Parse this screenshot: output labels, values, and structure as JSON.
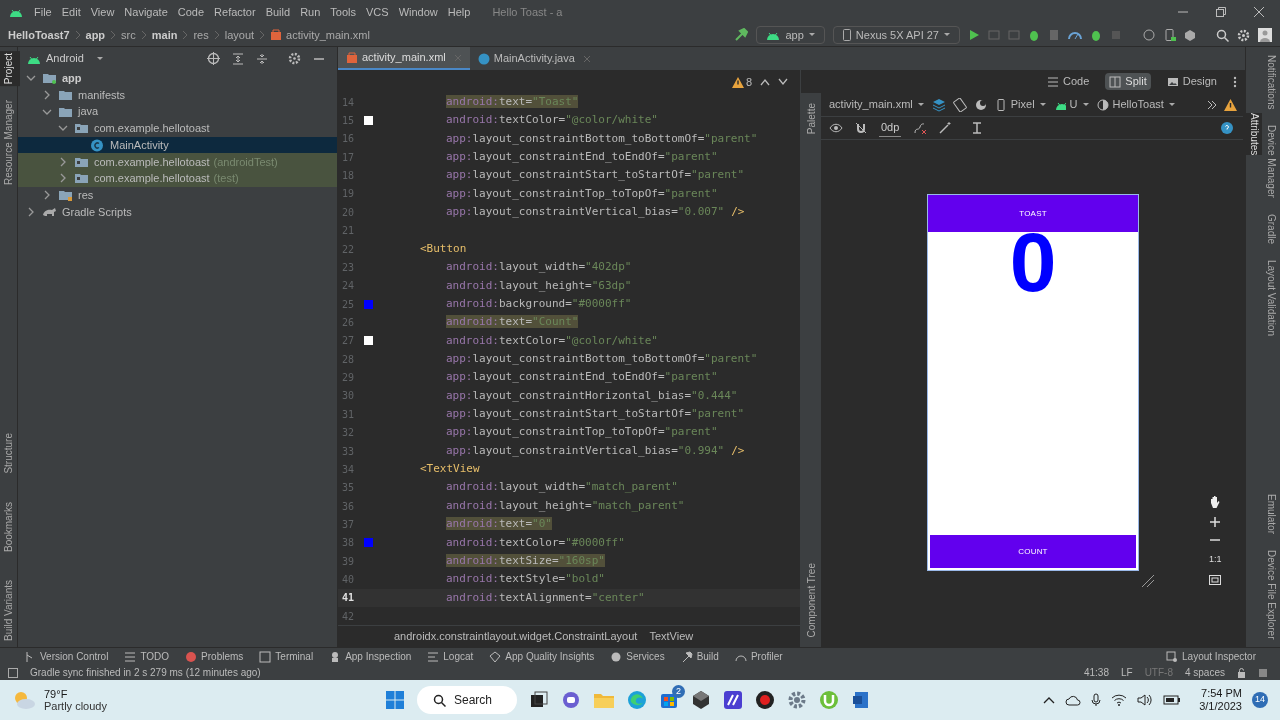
{
  "menu_bar": {
    "items": [
      "File",
      "Edit",
      "View",
      "Navigate",
      "Code",
      "Refactor",
      "Build",
      "Run",
      "Tools",
      "VCS",
      "Window",
      "Help"
    ],
    "title": "Hello Toast - a"
  },
  "breadcrumbs": [
    {
      "label": "HelloToast7",
      "bold": true
    },
    {
      "label": "app",
      "bold": true
    },
    {
      "label": "src",
      "bold": false
    },
    {
      "label": "main",
      "bold": true
    },
    {
      "label": "res",
      "bold": false
    },
    {
      "label": "layout",
      "bold": false
    },
    {
      "label": "activity_main.xml",
      "bold": false
    }
  ],
  "run_toolbar": {
    "configuration": "app",
    "device": "Nexus 5X API 27"
  },
  "left_tool_stripe": {
    "top": [
      {
        "label": "Project",
        "selected": true
      },
      {
        "label": "Resource Manager",
        "selected": false
      }
    ],
    "bottom": [
      {
        "label": "Structure",
        "selected": false
      },
      {
        "label": "Bookmarks",
        "selected": false
      },
      {
        "label": "Build Variants",
        "selected": false
      }
    ]
  },
  "project_panel": {
    "view": "Android",
    "tree": [
      {
        "label": "app",
        "kind": "module",
        "expanded": true,
        "selected": false,
        "children": [
          {
            "label": "manifests",
            "kind": "folder",
            "expanded": false,
            "selected": false
          },
          {
            "label": "java",
            "kind": "folder",
            "expanded": true,
            "selected": false,
            "children": [
              {
                "label": "com.example.hellotoast",
                "kind": "package",
                "expanded": true,
                "selected": false,
                "children": [
                  {
                    "label": "MainActivity",
                    "kind": "class",
                    "selected": true
                  }
                ]
              },
              {
                "label": "com.example.hellotoast",
                "suffix": "(androidTest)",
                "kind": "test_package",
                "expanded": false,
                "selected": false
              },
              {
                "label": "com.example.hellotoast",
                "suffix": "(test)",
                "kind": "test_package",
                "expanded": false,
                "selected": false
              }
            ]
          },
          {
            "label": "res",
            "kind": "resource_folder",
            "expanded": false,
            "selected": false
          }
        ]
      },
      {
        "label": "Gradle Scripts",
        "kind": "gradle",
        "expanded": false,
        "selected": false
      }
    ]
  },
  "editor": {
    "tabs": [
      {
        "label": "activity_main.xml",
        "kind": "xml",
        "selected": true
      },
      {
        "label": "MainActivity.java",
        "kind": "java",
        "selected": false
      }
    ],
    "warnings": "8",
    "lines": [
      {
        "number": "14",
        "kind": "attr",
        "name": "android:text=",
        "value": "\"Toast\"",
        "highlighted": true
      },
      {
        "number": "15",
        "kind": "attr",
        "name": "android:textColor=",
        "value": "\"@color/white\"",
        "color": "#ffffff"
      },
      {
        "number": "16",
        "kind": "attr",
        "name": "app:layout_constraintBottom_toBottomOf=",
        "value": "\"parent\""
      },
      {
        "number": "17",
        "kind": "attr",
        "name": "app:layout_constraintEnd_toEndOf=",
        "value": "\"parent\""
      },
      {
        "number": "18",
        "kind": "attr",
        "name": "app:layout_constraintStart_toStartOf=",
        "value": "\"parent\""
      },
      {
        "number": "19",
        "kind": "attr",
        "name": "app:layout_constraintTop_toTopOf=",
        "value": "\"parent\""
      },
      {
        "number": "20",
        "kind": "attr",
        "name": "app:layout_constraintVertical_bias=",
        "value": "\"0.007\"",
        "close": "/>"
      },
      {
        "number": "21",
        "kind": "blank"
      },
      {
        "number": "22",
        "kind": "tag",
        "text": "<Button"
      },
      {
        "number": "23",
        "kind": "attr",
        "name": "android:layout_width=",
        "value": "\"402dp\""
      },
      {
        "number": "24",
        "kind": "attr",
        "name": "android:layout_height=",
        "value": "\"63dp\""
      },
      {
        "number": "25",
        "kind": "attr",
        "name": "android:background=",
        "value": "\"#0000ff\"",
        "color": "#0000ff"
      },
      {
        "number": "26",
        "kind": "attr",
        "name": "android:text=",
        "value": "\"Count\"",
        "highlighted": true
      },
      {
        "number": "27",
        "kind": "attr",
        "name": "android:textColor=",
        "value": "\"@color/white\"",
        "color": "#ffffff"
      },
      {
        "number": "28",
        "kind": "attr",
        "name": "app:layout_constraintBottom_toBottomOf=",
        "value": "\"parent\""
      },
      {
        "number": "29",
        "kind": "attr",
        "name": "app:layout_constraintEnd_toEndOf=",
        "value": "\"parent\""
      },
      {
        "number": "30",
        "kind": "attr",
        "name": "app:layout_constraintHorizontal_bias=",
        "value": "\"0.444\""
      },
      {
        "number": "31",
        "kind": "attr",
        "name": "app:layout_constraintStart_toStartOf=",
        "value": "\"parent\""
      },
      {
        "number": "32",
        "kind": "attr",
        "name": "app:layout_constraintTop_toTopOf=",
        "value": "\"parent\""
      },
      {
        "number": "33",
        "kind": "attr",
        "name": "app:layout_constraintVertical_bias=",
        "value": "\"0.994\"",
        "close": "/>"
      },
      {
        "number": "34",
        "kind": "tag",
        "text": "<TextView"
      },
      {
        "number": "35",
        "kind": "attr",
        "name": "android:layout_width=",
        "value": "\"match_parent\""
      },
      {
        "number": "36",
        "kind": "attr",
        "name": "android:layout_height=",
        "value": "\"match_parent\""
      },
      {
        "number": "37",
        "kind": "attr",
        "name": "android:text=",
        "value": "\"0\"",
        "highlighted": true
      },
      {
        "number": "38",
        "kind": "attr",
        "name": "android:textColor=",
        "value": "\"#0000ff\"",
        "color": "#0000ff"
      },
      {
        "number": "39",
        "kind": "attr",
        "name": "android:textSize=",
        "value": "\"160sp\"",
        "highlighted": true
      },
      {
        "number": "40",
        "kind": "attr",
        "name": "android:textStyle=",
        "value": "\"bold\""
      },
      {
        "number": "41",
        "kind": "attr",
        "name": "android:textAlignment=",
        "value": "\"center\"",
        "current": true
      },
      {
        "number": "42",
        "kind": "blank"
      }
    ],
    "path": [
      "androidx.constraintlayout.widget.ConstraintLayout",
      "TextView"
    ]
  },
  "view_modes": [
    {
      "label": "Code",
      "selected": false
    },
    {
      "label": "Split",
      "selected": true
    },
    {
      "label": "Design",
      "selected": false
    }
  ],
  "design": {
    "file": "activity_main.xml",
    "device": "Pixel",
    "api": "U",
    "theme": "HelloToast",
    "margin": "0dp",
    "side_tabs": {
      "top": "Palette",
      "bottom": "Component Tree"
    },
    "attributes_tab": "Attributes",
    "preview": {
      "top_button": "TOAST",
      "counter": "0",
      "bottom_button": "COUNT"
    },
    "fit_label": "1:1"
  },
  "right_tool_stripe": {
    "top": [
      "Notifications",
      "Device Manager",
      "Gradle",
      "Layout Validation"
    ],
    "bottom": [
      "Emulator",
      "Device File Explorer"
    ]
  },
  "bottom_tools": {
    "left": [
      "Version Control",
      "TODO",
      "Problems",
      "Terminal",
      "App Inspection",
      "Logcat",
      "App Quality Insights",
      "Services",
      "Build",
      "Profiler"
    ],
    "right": "Layout Inspector"
  },
  "status_bar": {
    "message": "Gradle sync finished in 2 s 279 ms (12 minutes ago)",
    "position": "41:38",
    "line_separator": "LF",
    "encoding": "UTF-8",
    "indent": "4 spaces"
  },
  "taskbar": {
    "temperature": "79°F",
    "weather": "Partly cloudy",
    "search": "Search",
    "store_badge": "2",
    "time": "7:54 PM",
    "date": "3/1/2023",
    "notification_count": "14"
  }
}
